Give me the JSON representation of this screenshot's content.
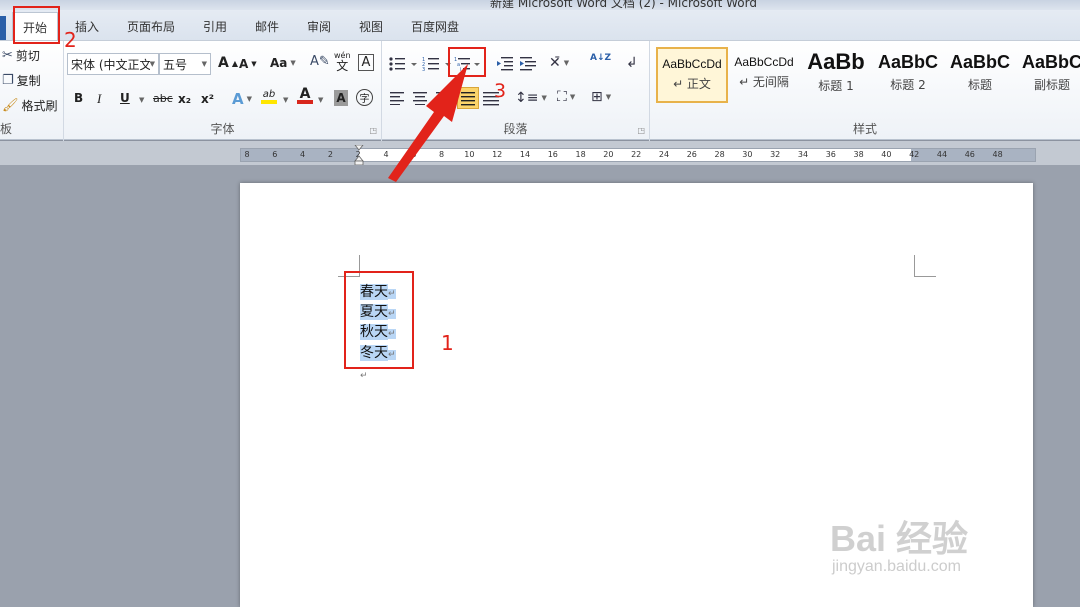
{
  "window": {
    "title": "新建 Microsoft Word 文档 (2) - Microsoft Word"
  },
  "tabs": [
    "开始",
    "插入",
    "页面布局",
    "引用",
    "邮件",
    "审阅",
    "视图",
    "百度网盘"
  ],
  "clipboard": {
    "cut": "剪切",
    "copy": "复制",
    "format_painter": "格式刷",
    "label": "板"
  },
  "font": {
    "family": "宋体 (中文正文",
    "size": "五号",
    "grow": "A",
    "shrink": "A",
    "change_case": "Aa",
    "pinyin": "wén",
    "pinyin_char": "文",
    "bold": "B",
    "italic": "I",
    "underline": "U",
    "strike": "abc",
    "subscript": "x₂",
    "superscript": "x²",
    "text_effect": "A",
    "highlight": "ab",
    "font_color": "A",
    "char_shade": "A",
    "enclose": "字",
    "label": "字体"
  },
  "paragraph": {
    "label": "段落",
    "sort_icon": "A↓Z"
  },
  "styles": {
    "label": "样式",
    "items": [
      {
        "sample": "AaBbCcDd",
        "name": "↵ 正文"
      },
      {
        "sample": "AaBbCcDd",
        "name": "↵ 无间隔"
      },
      {
        "sample": "AaBb",
        "name": "标题 1"
      },
      {
        "sample": "AaBbC",
        "name": "标题 2"
      },
      {
        "sample": "AaBbC",
        "name": "标题"
      },
      {
        "sample": "AaBbC",
        "name": "副标题"
      }
    ]
  },
  "ruler": {
    "ticks": [
      "8",
      "6",
      "4",
      "2",
      "2",
      "4",
      "6",
      "8",
      "10",
      "12",
      "14",
      "16",
      "18",
      "20",
      "22",
      "24",
      "26",
      "28",
      "30",
      "32",
      "34",
      "36",
      "38",
      "40",
      "42",
      "44",
      "46",
      "48"
    ]
  },
  "document": {
    "lines": [
      "春天",
      "夏天",
      "秋天",
      "冬天"
    ],
    "paragraph_mark": "↵"
  },
  "annotations": {
    "one": "1",
    "two": "2",
    "three": "3"
  },
  "watermark": {
    "logo": "Bai 经验",
    "url": "jingyan.baidu.com"
  },
  "colors": {
    "annotation_red": "#e2231a",
    "selection": "#b9d6f5",
    "selected_style": "#e8b24a",
    "highlight_yellow": "#ffe600",
    "font_color_red": "#d8261c"
  }
}
